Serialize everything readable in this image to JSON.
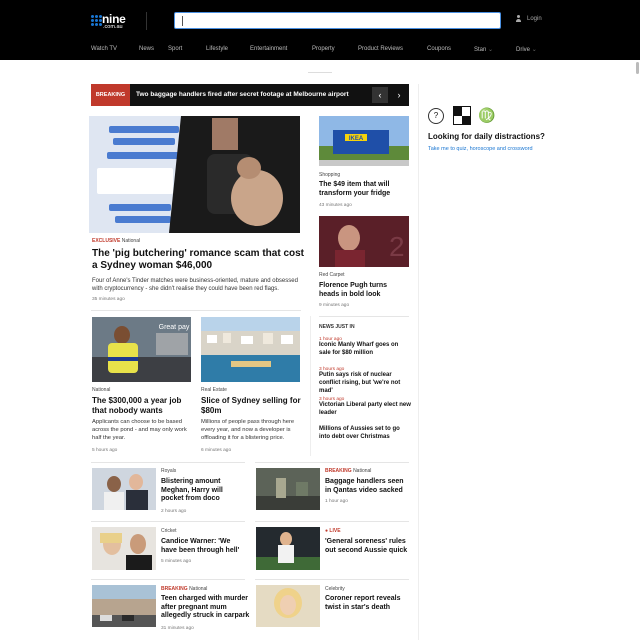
{
  "header": {
    "logo_word": "nine",
    "logo_sub": ".com.au",
    "login_label": "Login",
    "nav": [
      "Watch TV",
      "News",
      "Sport",
      "Lifestyle",
      "Entertainment",
      "Property",
      "Product Reviews",
      "Coupons",
      "Stan",
      "Drive"
    ]
  },
  "breaking": {
    "tag": "BREAKING",
    "headline": "Two baggage handlers fired after secret footage at Melbourne airport",
    "prev": "‹",
    "next": "›"
  },
  "hero": {
    "label_red": "EXCLUSIVE",
    "label": "National",
    "title": "The 'pig butchering' romance scam that cost a Sydney woman $46,000",
    "summary": "Four of Anne's Tinder matches were business-oriented, mature and obsessed with cryptocurrency - she didn't realise they could have been red flags.",
    "time": "35 minutes ago"
  },
  "side_stories": [
    {
      "label": "Shopping",
      "title": "The $49 item that will transform your fridge",
      "time": "43 minutes ago",
      "image_text": "IKEA"
    },
    {
      "label": "Red Carpet",
      "title": "Florence Pugh turns heads in bold look",
      "time": "9 minutes ago"
    }
  ],
  "news_just_in": {
    "heading": "NEWS JUST IN",
    "items": [
      {
        "time": "1 hour ago",
        "title": "Iconic Manly Wharf goes on sale for $80 million"
      },
      {
        "time": "3 hours ago",
        "title": "Putin says risk of nuclear conflict rising, but 'we're not mad'"
      },
      {
        "time": "3 hours ago",
        "title": "Victorian Liberal party elect new leader"
      },
      {
        "time": "",
        "title": "Millions of Aussies set to go into debt over Christmas"
      }
    ]
  },
  "mid_stories": [
    {
      "label": "National",
      "title": "The $300,000 a year job that nobody wants",
      "summary": "Applicants can choose to be based across the pond - and may only work half the year.",
      "time": "5 hours ago",
      "image_text": "Great pay"
    },
    {
      "label": "Real Estate",
      "title": "Slice of Sydney selling for $80m",
      "summary": "Millions of people pass through here every year, and now a developer is offloading it for a blistering price.",
      "time": "6 minutes ago"
    }
  ],
  "list_stories": [
    {
      "label_red": "",
      "label": "Royals",
      "title": "Blistering amount Meghan, Harry will pocket from doco",
      "time": "2 hours ago"
    },
    {
      "label_red": "BREAKING",
      "label": "National",
      "title": "Baggage handlers seen in Qantas video sacked",
      "time": "1 hour ago"
    },
    {
      "label_red": "",
      "label": "Cricket",
      "title": "Candice Warner: 'We have been through hell'",
      "time": "5 minutes ago"
    },
    {
      "label_red": "● LIVE",
      "label": "",
      "title": "'General soreness' rules out second Aussie quick",
      "time": ""
    },
    {
      "label_red": "BREAKING",
      "label": "National",
      "title": "Teen charged with murder after pregnant mum allegedly struck in carpark",
      "time": "31 minutes ago"
    },
    {
      "label_red": "",
      "label": "Celebrity",
      "title": "Coroner report reveals twist in star's death",
      "time": ""
    }
  ],
  "distractions": {
    "icons": [
      "quiz-icon",
      "crossword-icon",
      "horoscope-icon"
    ],
    "quiz_glyph": "?",
    "horoscope_glyph": "♍",
    "heading": "Looking for daily distractions?",
    "link": "Take me to quiz, horoscope and crossword"
  },
  "colors": {
    "accent_red": "#c0392b",
    "link_blue": "#1976d2",
    "header_bg": "#000000"
  }
}
